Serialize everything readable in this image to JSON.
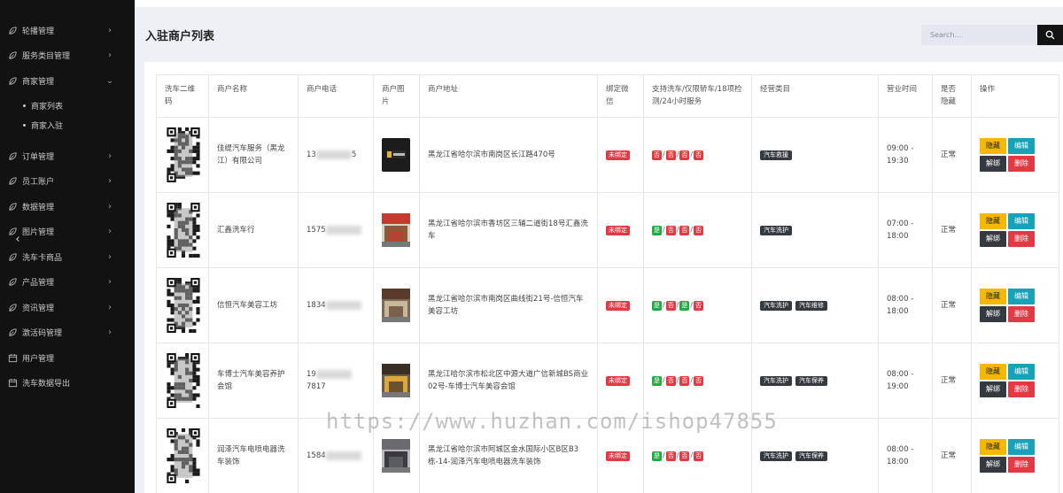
{
  "sidebar": {
    "items": [
      {
        "label": "轮播管理",
        "icon": "leaf-icon",
        "chevron": "›"
      },
      {
        "label": "服务类目管理",
        "icon": "leaf-icon",
        "chevron": "›"
      },
      {
        "label": "商家管理",
        "icon": "leaf-icon",
        "chevron": "⌄"
      },
      {
        "label": "订单管理",
        "icon": "leaf-icon",
        "chevron": "›"
      },
      {
        "label": "员工账户",
        "icon": "leaf-icon",
        "chevron": "›"
      },
      {
        "label": "数据管理",
        "icon": "leaf-icon",
        "chevron": "›"
      },
      {
        "label": "图片管理",
        "icon": "leaf-icon",
        "chevron": "›"
      },
      {
        "label": "洗车卡商品",
        "icon": "leaf-icon",
        "chevron": "›"
      },
      {
        "label": "产品管理",
        "icon": "leaf-icon",
        "chevron": "›"
      },
      {
        "label": "资讯管理",
        "icon": "leaf-icon",
        "chevron": "›"
      },
      {
        "label": "激活码管理",
        "icon": "leaf-icon",
        "chevron": "›"
      },
      {
        "label": "用户管理",
        "icon": "calendar-icon"
      },
      {
        "label": "洗车数据导出",
        "icon": "calendar-icon"
      }
    ],
    "submenu": [
      {
        "label": "商家列表"
      },
      {
        "label": "商家入驻"
      }
    ],
    "collapse_glyph": "‹"
  },
  "header": {
    "title": "入驻商户列表",
    "search_placeholder": "Search..."
  },
  "table": {
    "columns": [
      "洗车二维码",
      "商户名称",
      "商户电话",
      "商户图片",
      "商户地址",
      "绑定微信",
      "支持洗车/仅限轿车/18项检测/24小时服务",
      "经营类目",
      "营业时间",
      "是否隐藏",
      "操作"
    ],
    "rows": [
      {
        "name": "佳缇汽车服务（黑龙江）有限公司",
        "phone_visible": "13",
        "phone_tail": "5",
        "address": "黑龙江省哈尔滨市南岗区长江路470号",
        "wechat": "未绑定",
        "flags": [
          {
            "text": "否",
            "color": "red"
          },
          {
            "text": "否",
            "color": "red"
          },
          {
            "text": "否",
            "color": "red"
          },
          {
            "text": "否",
            "color": "red"
          }
        ],
        "categories": [
          "汽车救援"
        ],
        "hours_open": "09:00 -",
        "hours_close": "19:30",
        "hidden": "正常"
      },
      {
        "name": "汇鑫洗车行",
        "phone_visible": "1575",
        "phone_tail": "",
        "address": "黑龙江省哈尔滨市香坊区三辅二道街18号汇鑫洗车",
        "wechat": "未绑定",
        "flags": [
          {
            "text": "是",
            "color": "green"
          },
          {
            "text": "否",
            "color": "red"
          },
          {
            "text": "否",
            "color": "red"
          },
          {
            "text": "否",
            "color": "red"
          }
        ],
        "categories": [
          "汽车洗护"
        ],
        "hours_open": "07:00 -",
        "hours_close": "18:00",
        "hidden": "正常"
      },
      {
        "name": "信恒汽车美容工坊",
        "phone_visible": "1834",
        "phone_tail": "",
        "address": "黑龙江省哈尔滨市南岗区曲线街21号-信恒汽车美容工坊",
        "wechat": "未绑定",
        "flags": [
          {
            "text": "是",
            "color": "green"
          },
          {
            "text": "否",
            "color": "red"
          },
          {
            "text": "是",
            "color": "green"
          },
          {
            "text": "否",
            "color": "red"
          }
        ],
        "categories": [
          "汽车洗护",
          "汽车维修"
        ],
        "hours_open": "08:00 -",
        "hours_close": "18:00",
        "hidden": "正常"
      },
      {
        "name": "车博士汽车美容养护会馆",
        "phone_visible": "19",
        "phone_tail": "7817",
        "address": "黑龙江哈尔滨市松北区中源大道广信新城BS商业02号-车博士汽车美容会馆",
        "wechat": "未绑定",
        "flags": [
          {
            "text": "是",
            "color": "green"
          },
          {
            "text": "否",
            "color": "red"
          },
          {
            "text": "否",
            "color": "red"
          },
          {
            "text": "否",
            "color": "red"
          }
        ],
        "categories": [
          "汽车洗护",
          "汽车保养"
        ],
        "hours_open": "08:00 -",
        "hours_close": "19:00",
        "hidden": "正常"
      },
      {
        "name": "润泽汽车电喷电器洗车装饰",
        "phone_visible": "1584",
        "phone_tail": "",
        "address": "黑龙江省哈尔滨市阿城区金水国际小区B区B3栋-14-润泽汽车电喷电器洗车装饰",
        "wechat": "未绑定",
        "flags": [
          {
            "text": "是",
            "color": "green"
          },
          {
            "text": "否",
            "color": "red"
          },
          {
            "text": "否",
            "color": "red"
          },
          {
            "text": "否",
            "color": "red"
          }
        ],
        "categories": [
          "汽车洗护",
          "汽车保养"
        ],
        "hours_open": "08:00 -",
        "hours_close": "18:00",
        "hidden": "正常"
      }
    ],
    "actions": {
      "hide": "隐藏",
      "edit": "编辑",
      "unbind": "解绑",
      "delete": "删除"
    },
    "flag_separator": "/"
  },
  "watermark": "https://www.huzhan.com/ishop47855"
}
